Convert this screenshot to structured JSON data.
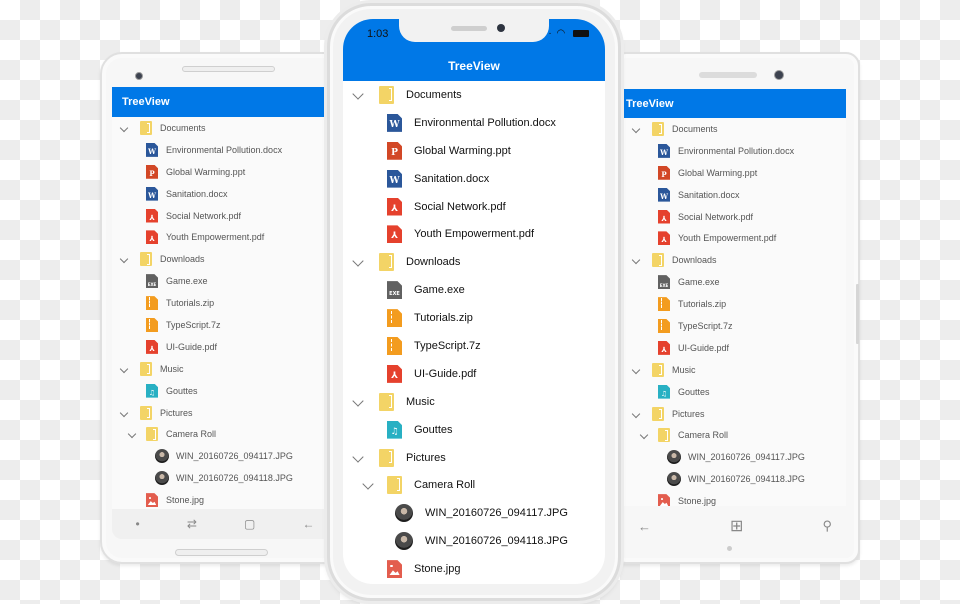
{
  "app": {
    "title": "TreeView",
    "accent_color": "#0078e7"
  },
  "iphone": {
    "status_time": "1:03",
    "status_icons": "wifi-icon battery-icon"
  },
  "tree": [
    {
      "label": "Documents",
      "type": "folder",
      "level": 0,
      "expanded": true
    },
    {
      "label": "Environmental Pollution.docx",
      "type": "word",
      "level": 1
    },
    {
      "label": "Global Warming.ppt",
      "type": "ppt",
      "level": 1
    },
    {
      "label": "Sanitation.docx",
      "type": "word",
      "level": 1
    },
    {
      "label": "Social Network.pdf",
      "type": "pdf",
      "level": 1
    },
    {
      "label": "Youth Empowerment.pdf",
      "type": "pdf",
      "level": 1
    },
    {
      "label": "Downloads",
      "type": "folder",
      "level": 0,
      "expanded": true
    },
    {
      "label": "Game.exe",
      "type": "exe",
      "level": 1
    },
    {
      "label": "Tutorials.zip",
      "type": "zip",
      "level": 1
    },
    {
      "label": "TypeScript.7z",
      "type": "zip",
      "level": 1
    },
    {
      "label": "UI-Guide.pdf",
      "type": "pdf",
      "level": 1
    },
    {
      "label": "Music",
      "type": "folder",
      "level": 0,
      "expanded": true
    },
    {
      "label": "Gouttes",
      "type": "audio",
      "level": 1
    },
    {
      "label": "Pictures",
      "type": "folder",
      "level": 0,
      "expanded": true
    },
    {
      "label": "Camera Roll",
      "type": "folder",
      "level": 1,
      "expanded": true
    },
    {
      "label": "WIN_20160726_094117.JPG",
      "type": "avatar",
      "level": 2
    },
    {
      "label": "WIN_20160726_094118.JPG",
      "type": "avatar",
      "level": 2
    },
    {
      "label": "Stone.jpg",
      "type": "image",
      "level": 1
    }
  ],
  "icon_glyphs": {
    "word": "W",
    "ppt": "P",
    "pdf": "⅄",
    "exe": "EXE",
    "audio": "♫"
  },
  "android_nav": {
    "dot": "•",
    "recents": "⇄",
    "home": "▢",
    "back": "←"
  },
  "windows_nav": {
    "back": "←",
    "start": "⊞",
    "search": "⚲"
  }
}
